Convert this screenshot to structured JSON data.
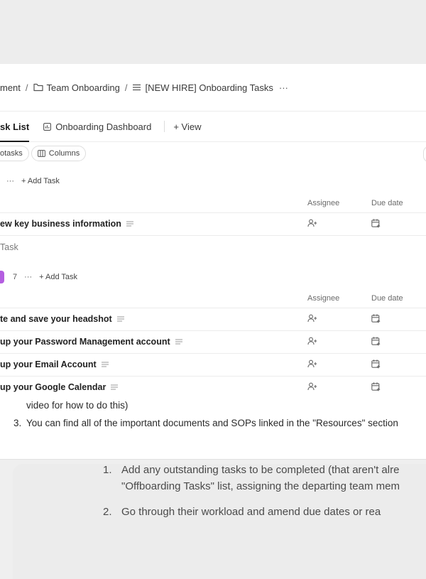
{
  "breadcrumb": {
    "seg1": "ment",
    "seg2": "Team Onboarding",
    "seg3": "[NEW HIRE] Onboarding Tasks",
    "more": "···"
  },
  "tabs": {
    "task_list": "sk List",
    "dashboard": "Onboarding Dashboard",
    "add_view": "+ View"
  },
  "toolbar": {
    "subtasks": "otasks",
    "columns": "Columns"
  },
  "group1": {
    "more": "···",
    "add_task": "+ Add Task",
    "col_assignee": "Assignee",
    "col_due": "Due date",
    "rows": [
      {
        "name": "ew key business information"
      }
    ],
    "add_inline": "Task"
  },
  "group2": {
    "count": "7",
    "more": "···",
    "add_task": "+ Add Task",
    "col_assignee": "Assignee",
    "col_due": "Due date",
    "rows": [
      {
        "name": "te and save your headshot"
      },
      {
        "name": "up your Password Management account"
      },
      {
        "name": "up your Email Account"
      },
      {
        "name": "up your Google Calendar"
      }
    ],
    "accent": "#b45ee0"
  },
  "doc": {
    "line1": "video for how to do this)",
    "line2_num": "3.",
    "line2": "You can find all of the important documents and SOPs linked in the \"Resources\" section",
    "item1_num": "1.",
    "item1_a": "Add any outstanding tasks to be completed (that aren't alre",
    "item1_b": "\"Offboarding Tasks\" list, assigning the departing team mem",
    "item2_num": "2.",
    "item2": "Go through their workload and amend due dates or rea"
  }
}
